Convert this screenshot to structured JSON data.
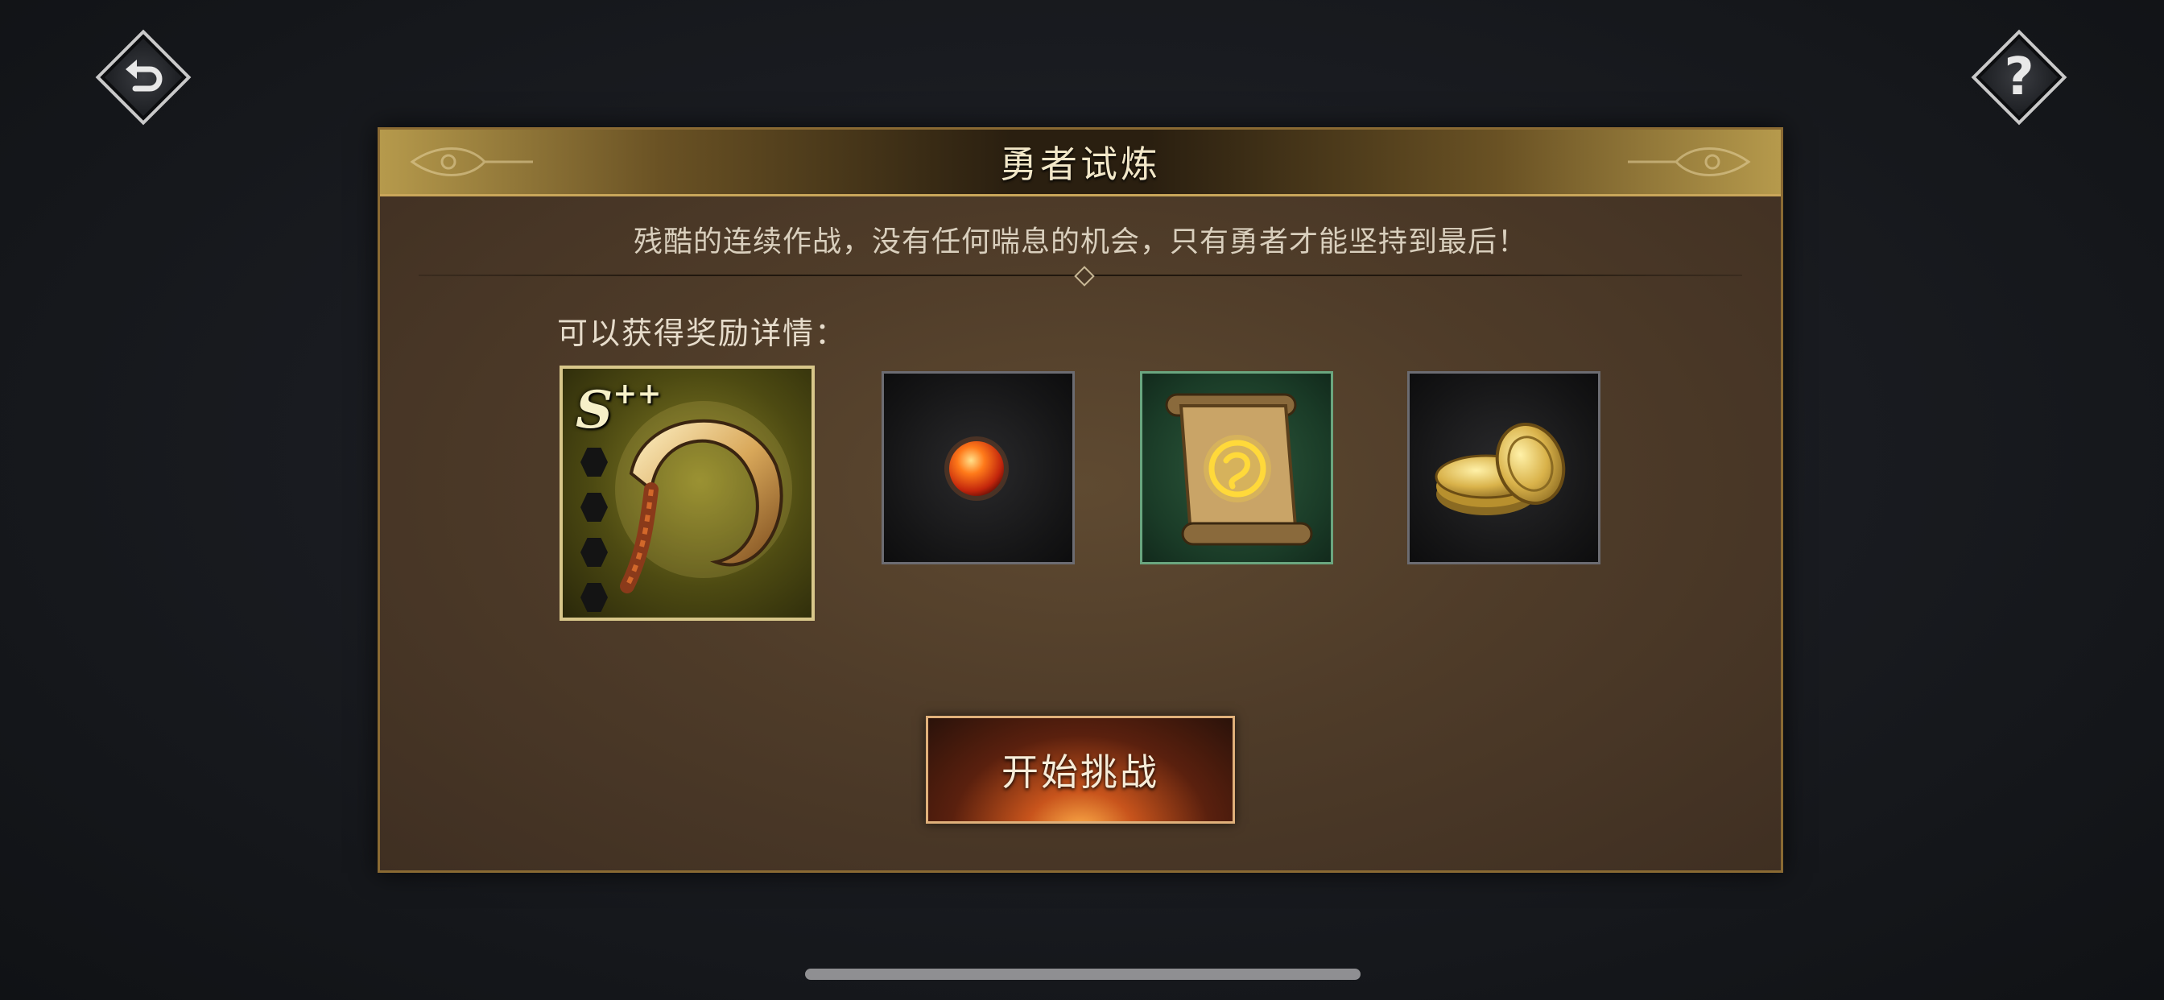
{
  "header": {
    "back_icon": "back-arrow-icon",
    "help_icon": "question-mark-icon",
    "help_glyph": "?"
  },
  "dialog": {
    "title": "勇者试炼",
    "description": "残酷的连续作战，没有任何喘息的机会，只有勇者才能坚持到最后！",
    "reward_label": "可以获得奖励详情：",
    "rewards": [
      {
        "icon": "golden-scythe-weapon-icon",
        "grade": "S",
        "grade_suffix": "++",
        "frame_color": "#d8c78a"
      },
      {
        "icon": "red-orb-icon",
        "frame_color": "#6c6c72"
      },
      {
        "icon": "magic-scroll-icon",
        "frame_color": "#6aa67f"
      },
      {
        "icon": "gold-coins-icon",
        "frame_color": "#6c6c72"
      }
    ],
    "start_button": "开始挑战"
  },
  "colors": {
    "accent_gold": "#c9a65a",
    "button_glow": "#ffb04a"
  }
}
